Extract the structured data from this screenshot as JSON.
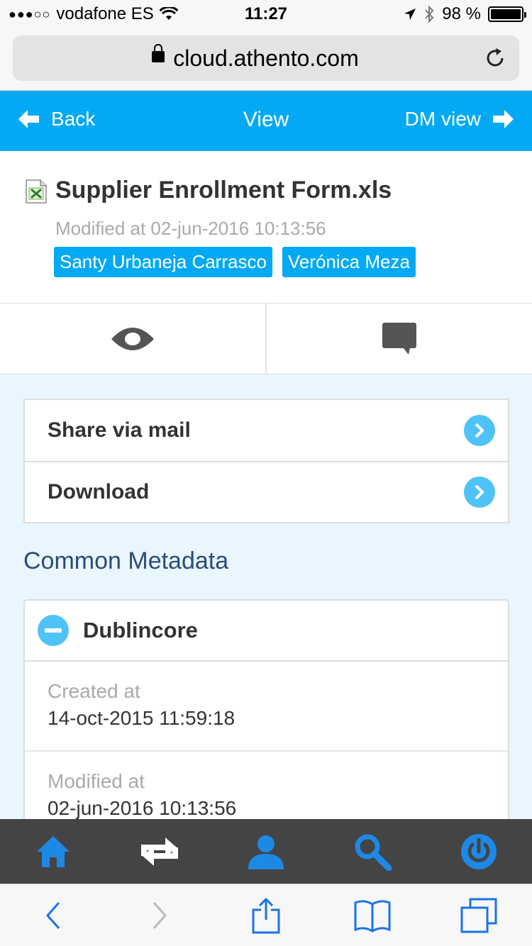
{
  "status_bar": {
    "signal": "●●●○○",
    "carrier": "vodafone ES",
    "time": "11:27",
    "battery": "98 %"
  },
  "browser": {
    "url": "cloud.athento.com"
  },
  "header": {
    "back_label": "Back",
    "title": "View",
    "dm_view_label": "DM view"
  },
  "document": {
    "file_name": "Supplier Enrollment Form.xls",
    "modified": "Modified at 02-jun-2016 10:13:56",
    "tags": [
      "Santy Urbaneja Carrasco",
      "Verónica Meza"
    ]
  },
  "actions": {
    "items": [
      {
        "label": "Share via mail"
      },
      {
        "label": "Download"
      }
    ]
  },
  "metadata": {
    "section_title": "Common Metadata",
    "group_title": "Dublincore",
    "fields": [
      {
        "label": "Created at",
        "value": "14-oct-2015 11:59:18"
      },
      {
        "label": "Modified at",
        "value": "02-jun-2016 10:13:56"
      }
    ]
  },
  "colors": {
    "accent": "#03a9f4",
    "nav_active": "#1e88e5",
    "nav_bg": "#444444"
  },
  "app_nav": [
    "home-icon",
    "transfer-icon",
    "user-icon",
    "search-icon",
    "power-icon"
  ],
  "safari_toolbar": [
    "back-icon",
    "forward-icon",
    "share-icon",
    "bookmarks-icon",
    "tabs-icon"
  ]
}
